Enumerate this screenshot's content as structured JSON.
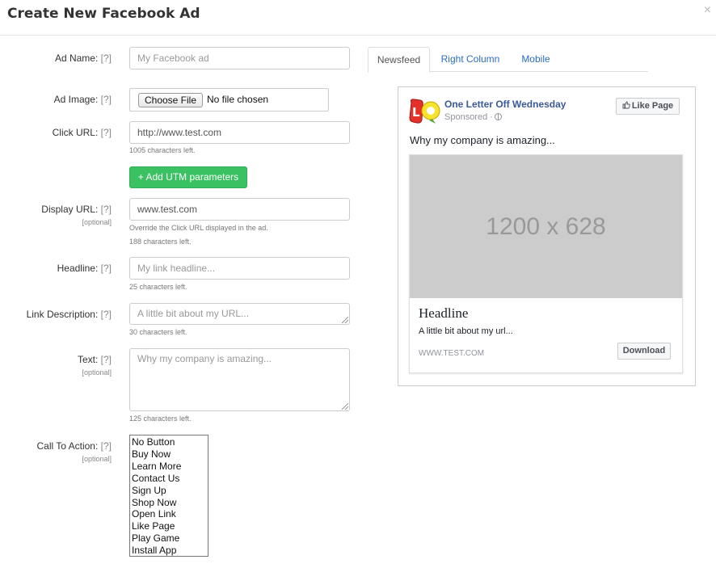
{
  "modal": {
    "title": "Create New Facebook Ad",
    "close": "×"
  },
  "form": {
    "help": "[?]",
    "optional": "[optional]",
    "ad_name": {
      "label": "Ad Name:",
      "placeholder": "My Facebook ad"
    },
    "ad_image": {
      "label": "Ad Image:",
      "button": "Choose File",
      "status": "No file chosen"
    },
    "click_url": {
      "label": "Click URL:",
      "value": "http://www.test.com",
      "hint": "1005 characters left."
    },
    "utm_button": "+ Add UTM parameters",
    "display_url": {
      "label": "Display URL:",
      "value": "www.test.com",
      "hint1": "Override the Click URL displayed in the ad.",
      "hint2": "188 characters left."
    },
    "headline": {
      "label": "Headline:",
      "placeholder": "My link headline...",
      "hint": "25 characters left."
    },
    "link_description": {
      "label": "Link Description:",
      "placeholder": "A little bit about my URL...",
      "hint": "30 characters left."
    },
    "text": {
      "label": "Text:",
      "placeholder": "Why my company is amazing...",
      "hint": "125 characters left."
    },
    "cta": {
      "label": "Call To Action:",
      "options": [
        "No Button",
        "Buy Now",
        "Learn More",
        "Contact Us",
        "Sign Up",
        "Shop Now",
        "Open Link",
        "Like Page",
        "Play Game",
        "Install App"
      ]
    }
  },
  "preview": {
    "tabs": [
      {
        "label": "Newsfeed"
      },
      {
        "label": "Right Column"
      },
      {
        "label": "Mobile"
      }
    ],
    "active_tab": "Newsfeed",
    "page_name": "One Letter Off Wednesday",
    "sponsored": "Sponsored ·",
    "like_page": "Like Page",
    "post_text": "Why my company is amazing...",
    "image_label": "1200 x 628",
    "headline": "Headline",
    "description": "A little bit about my url...",
    "domain": "WWW.TEST.COM",
    "cta_button": "Download"
  }
}
